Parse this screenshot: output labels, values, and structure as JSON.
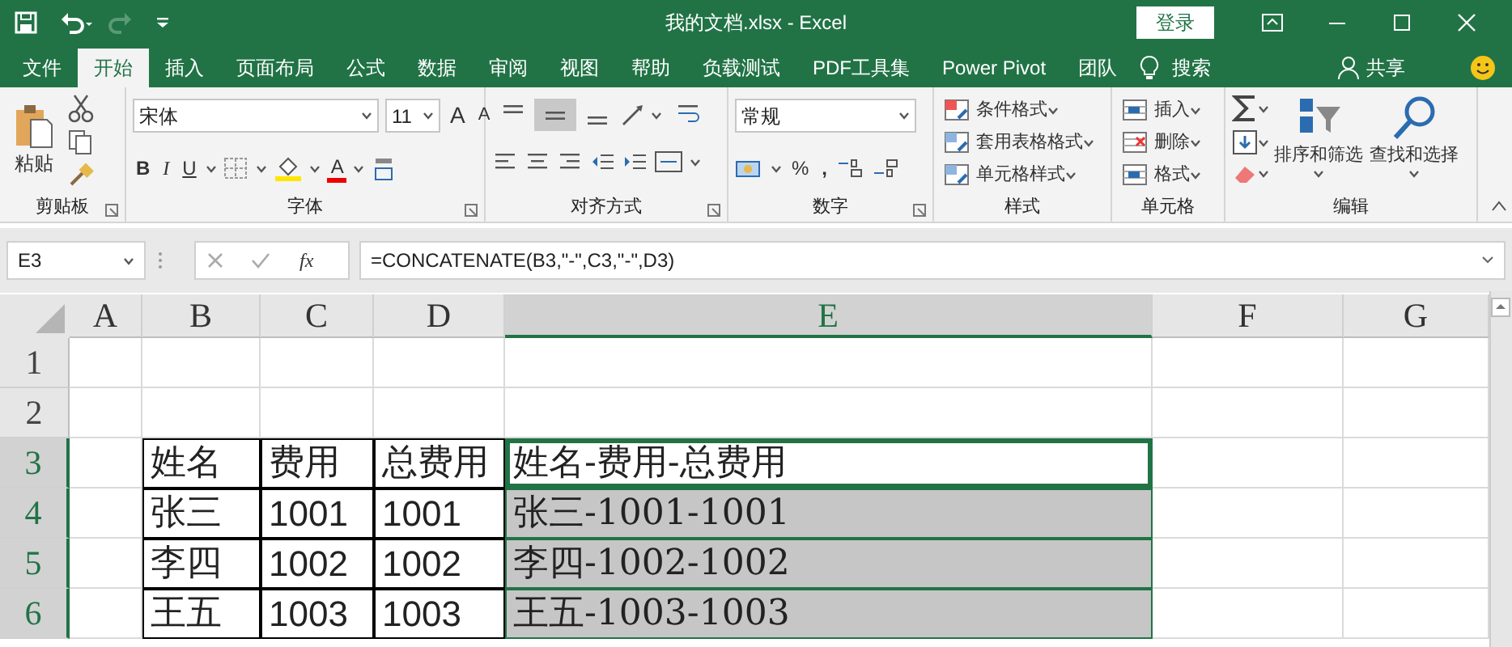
{
  "title_bar": {
    "title": "我的文档.xlsx  -  Excel",
    "login_button": "登录"
  },
  "ribbon_tabs": [
    {
      "label": "文件",
      "selected": false
    },
    {
      "label": "开始",
      "selected": true
    },
    {
      "label": "插入",
      "selected": false
    },
    {
      "label": "页面布局",
      "selected": false
    },
    {
      "label": "公式",
      "selected": false
    },
    {
      "label": "数据",
      "selected": false
    },
    {
      "label": "审阅",
      "selected": false
    },
    {
      "label": "视图",
      "selected": false
    },
    {
      "label": "帮助",
      "selected": false
    },
    {
      "label": "负载测试",
      "selected": false
    },
    {
      "label": "PDF工具集",
      "selected": false
    },
    {
      "label": "Power Pivot",
      "selected": false
    },
    {
      "label": "团队",
      "selected": false
    }
  ],
  "search": {
    "label": "搜索"
  },
  "share": {
    "label": "共享"
  },
  "ribbon": {
    "clipboard": {
      "paste": "粘贴",
      "label": "剪贴板"
    },
    "font": {
      "font_name": "宋体",
      "font_size": "11",
      "grow": "A",
      "shrink": "A",
      "bold": "B",
      "italic": "I",
      "underline": "U",
      "font_color": "A",
      "label": "字体"
    },
    "alignment": {
      "buttons": [
        {
          "kind": "top",
          "selected": false
        },
        {
          "kind": "middle",
          "selected": true
        },
        {
          "kind": "bottom",
          "selected": false
        }
      ],
      "label": "对齐方式"
    },
    "number": {
      "format": "常规",
      "percent": "%",
      "comma": ",",
      "label": "数字"
    },
    "styles": {
      "items": [
        "条件格式",
        "套用表格格式",
        "单元格样式"
      ],
      "label": "样式"
    },
    "cells": {
      "items": [
        "插入",
        "删除",
        "格式"
      ],
      "label": "单元格"
    },
    "editing": {
      "items": [
        "排序和筛选",
        "查找和选择"
      ],
      "label": "编辑"
    }
  },
  "formula_bar": {
    "name_box": "E3",
    "fx": "fx",
    "formula": "=CONCATENATE(B3,\"-\",C3,\"-\",D3)"
  },
  "sheet": {
    "columns": [
      {
        "label": "A",
        "selected": false
      },
      {
        "label": "B",
        "selected": false
      },
      {
        "label": "C",
        "selected": false
      },
      {
        "label": "D",
        "selected": false
      },
      {
        "label": "E",
        "selected": true
      },
      {
        "label": "F",
        "selected": false
      },
      {
        "label": "G",
        "selected": false
      }
    ],
    "rows": [
      {
        "number": "1",
        "selected": false,
        "cells": [
          "",
          "",
          "",
          "",
          "",
          "",
          ""
        ]
      },
      {
        "number": "2",
        "selected": false,
        "cells": [
          "",
          "",
          "",
          "",
          "",
          "",
          ""
        ]
      },
      {
        "number": "3",
        "selected": true,
        "cells": [
          "",
          "姓名",
          "费用",
          "总费用",
          "姓名-费用-总费用",
          "",
          ""
        ]
      },
      {
        "number": "4",
        "selected": true,
        "cells": [
          "",
          "张三",
          "1001",
          "1001",
          "张三-1001-1001",
          "",
          ""
        ]
      },
      {
        "number": "5",
        "selected": true,
        "cells": [
          "",
          "李四",
          "1002",
          "1002",
          "李四-1002-1002",
          "",
          ""
        ]
      },
      {
        "number": "6",
        "selected": true,
        "cells": [
          "",
          "王五",
          "1003",
          "1003",
          "王五-1003-1003",
          "",
          ""
        ]
      }
    ]
  }
}
